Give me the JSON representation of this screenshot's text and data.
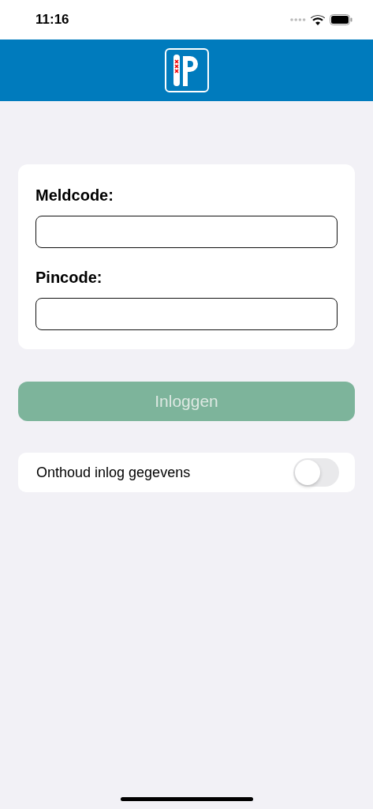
{
  "status_bar": {
    "time": "11:16"
  },
  "form": {
    "fields": [
      {
        "label": "Meldcode:"
      },
      {
        "label": "Pincode:"
      }
    ]
  },
  "login_button": {
    "label": "Inloggen",
    "disabled": true
  },
  "remember": {
    "label": "Onthoud inlog gegevens",
    "on": false
  }
}
